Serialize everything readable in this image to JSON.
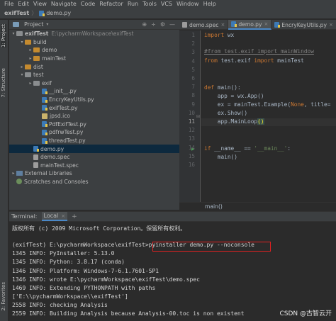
{
  "menubar": {
    "items": [
      "File",
      "Edit",
      "View",
      "Navigate",
      "Code",
      "Refactor",
      "Run",
      "Tools",
      "VCS",
      "Window",
      "Help"
    ]
  },
  "navbar": {
    "crumbs": [
      "exifTest",
      "demo.py"
    ],
    "separator": "〉"
  },
  "left_strip": {
    "project": "1: Project",
    "structure": "7: Structure",
    "favorites": "2: Favorites"
  },
  "project_panel": {
    "title": "Project",
    "tools": [
      "⊕",
      "÷",
      "⚙",
      "—"
    ],
    "tree": [
      {
        "label": "exifTest",
        "path": "E:\\pycharmWorkspace\\exifTest",
        "icon": "folder",
        "arrow": "▾",
        "depth": 0
      },
      {
        "label": "build",
        "icon": "folder-excl",
        "arrow": "▾",
        "depth": 1
      },
      {
        "label": "demo",
        "icon": "folder-excl",
        "arrow": "▸",
        "depth": 2
      },
      {
        "label": "mainTest",
        "icon": "folder-excl",
        "arrow": "▸",
        "depth": 2
      },
      {
        "label": "dist",
        "icon": "folder-excl",
        "arrow": "▸",
        "depth": 1
      },
      {
        "label": "test",
        "icon": "folder",
        "arrow": "▾",
        "depth": 1
      },
      {
        "label": "exif",
        "icon": "folder",
        "arrow": "▸",
        "depth": 2
      },
      {
        "label": "__init__.py",
        "icon": "py",
        "arrow": "",
        "depth": 3
      },
      {
        "label": "EncryKeyUtils.py",
        "icon": "py",
        "arrow": "",
        "depth": 3
      },
      {
        "label": "exifTest.py",
        "icon": "py",
        "arrow": "",
        "depth": 3
      },
      {
        "label": "jpsd.ico",
        "icon": "ico-file",
        "arrow": "",
        "depth": 3
      },
      {
        "label": "PdfExifTest.py",
        "icon": "py",
        "arrow": "",
        "depth": 3
      },
      {
        "label": "pdfrwTest.py",
        "icon": "py",
        "arrow": "",
        "depth": 3
      },
      {
        "label": "threadTest.py",
        "icon": "py",
        "arrow": "",
        "depth": 3
      },
      {
        "label": "demo.py",
        "icon": "py",
        "arrow": "",
        "depth": 2,
        "selected": true
      },
      {
        "label": "demo.spec",
        "icon": "spec",
        "arrow": "",
        "depth": 2
      },
      {
        "label": "mainTest.spec",
        "icon": "spec",
        "arrow": "",
        "depth": 2
      },
      {
        "label": "External Libraries",
        "icon": "lib",
        "arrow": "▸",
        "depth": 0
      },
      {
        "label": "Scratches and Consoles",
        "icon": "scratch",
        "arrow": "",
        "depth": 0
      }
    ]
  },
  "editor": {
    "tabs": [
      {
        "label": "demo.spec",
        "icon": "spec",
        "active": false
      },
      {
        "label": "demo.py",
        "icon": "py",
        "active": true
      },
      {
        "label": "EncryKeyUtils.py",
        "icon": "py",
        "active": false
      }
    ],
    "close_glyph": "×",
    "line_numbers": [
      "1",
      "2",
      "3",
      "4",
      "5",
      "6",
      "7",
      "8",
      "9",
      "10",
      "11",
      "12",
      "13",
      "14",
      "15",
      "16"
    ],
    "current_line": "11",
    "code": {
      "l1_kw": "import",
      "l1_rest": " wx",
      "l3_comment": "#from test.exif import mainWindow",
      "l4_kw1": "from",
      "l4_mid": " test.exif ",
      "l4_kw2": "import",
      "l4_rest": " mainTest",
      "l7_kw": "def",
      "l7_rest": " main():",
      "l8": "    app = wx.App()",
      "l9_a": "    ex = mainTest.Example(",
      "l9_kw": "None",
      "l9_b": ", title=",
      "l10": "    ex.Show()",
      "l11_a": "    app.MainLoop",
      "l11_paren": "()",
      "l14_kw": "if",
      "l14_a": " __name__ == ",
      "l14_str": "'__main__'",
      "l14_b": ":",
      "l15": "    main()"
    },
    "breadcrumb": "main()"
  },
  "terminal": {
    "label": "Terminal:",
    "tab": "Local",
    "tab_close": "×",
    "lines": [
      "版权所有 (c) 2009 Microsoft Corporation。保留所有权利。",
      "",
      "(exifTest) E:\\pycharmWorkspace\\exifTest>pyinstaller demo.py --noconsole",
      "1345 INFO: PyInstaller: 5.13.0",
      "1345 INFO: Python: 3.8.17 (conda)",
      "1346 INFO: Platform: Windows-7-6.1.7601-SP1",
      "1346 INFO: wrote E:\\pycharmWorkspace\\exifTest\\demo.spec",
      "1469 INFO: Extending PYTHONPATH with paths",
      "['E:\\\\pycharmWorkspace\\\\exifTest']",
      "2558 INFO: checking Analysis",
      "2559 INFO: Building Analysis because Analysis-00.toc is non existent"
    ]
  },
  "watermark": "CSDN @古智云开",
  "colors": {
    "selection": "#0d293e",
    "accent_tab": "#4a88c7",
    "highlight_box": "#e02020"
  }
}
